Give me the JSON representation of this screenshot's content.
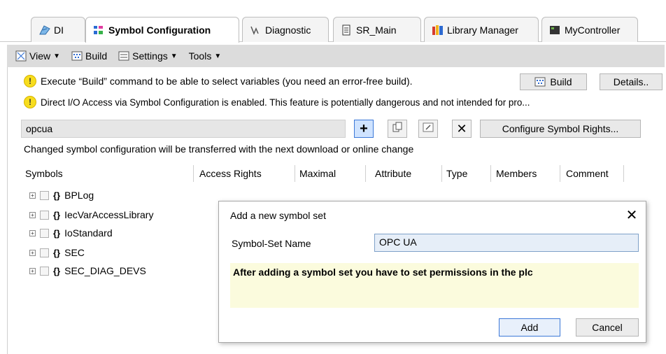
{
  "tabs": [
    {
      "label": "DI",
      "icon": "di-device-icon"
    },
    {
      "label": "Symbol Configuration",
      "icon": "symbol-configuration-icon",
      "active": true
    },
    {
      "label": "Diagnostic",
      "icon": "diagnostic-icon"
    },
    {
      "label": "SR_Main",
      "icon": "document-icon"
    },
    {
      "label": "Library Manager",
      "icon": "library-manager-icon"
    },
    {
      "label": "MyController",
      "icon": "controller-icon"
    }
  ],
  "toolbar": {
    "view_label": "View",
    "build_label": "Build",
    "settings_label": "Settings",
    "tools_label": "Tools"
  },
  "info": {
    "build_message": "Execute “Build” command to be able to select variables (you need an error-free build).",
    "direct_io_message": "Direct I/O Access via Symbol Configuration is enabled. This feature is potentially dangerous and not intended for pro...",
    "build_button": "Build",
    "details_button": "Details.."
  },
  "symbol_set": {
    "current": "opcua",
    "configure_rights_button": "Configure Symbol Rights...",
    "changed_notice": "Changed symbol configuration will be transferred with the next download or online change"
  },
  "columns": [
    "Symbols",
    "Access Rights",
    "Maximal",
    "Attribute",
    "Type",
    "Members",
    "Comment"
  ],
  "tree": [
    {
      "brace": "{}",
      "name": "BPLog"
    },
    {
      "brace": "{}",
      "name": "IecVarAccessLibrary"
    },
    {
      "brace": "{}",
      "name": "IoStandard"
    },
    {
      "brace": "{}",
      "name": "SEC"
    },
    {
      "brace": "{}",
      "name": "SEC_DIAG_DEVS"
    }
  ],
  "dialog": {
    "title": "Add a new symbol set",
    "close_glyph": "✕",
    "name_label": "Symbol-Set Name",
    "name_value": "OPC UA",
    "note": "After adding a symbol set you have to set permissions in the plc",
    "add_button": "Add",
    "cancel_button": "Cancel"
  },
  "colors": {
    "toolbar_bg": "#dcdcdc",
    "note_bg": "#fbfbdd",
    "warning_yellow": "#f7dd1e",
    "accent_blue": "#3c78d8"
  }
}
